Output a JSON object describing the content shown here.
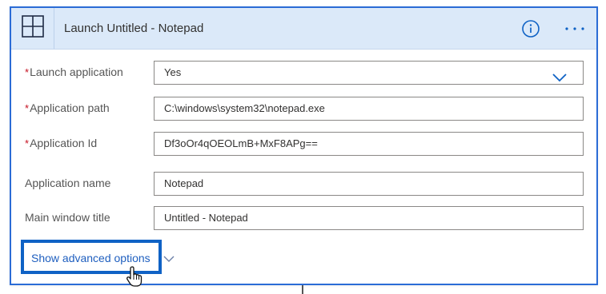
{
  "card": {
    "title": "Launch Untitled - Notepad",
    "icon": "window-layout-icon",
    "info_icon": "info-icon",
    "more_icon": "more-options-icon"
  },
  "fields": {
    "launch_application": {
      "label": "Launch application",
      "required": "*",
      "value": "Yes"
    },
    "application_path": {
      "label": "Application path",
      "required": "*",
      "value": "C:\\windows\\system32\\notepad.exe"
    },
    "application_id": {
      "label": "Application Id",
      "required": "*",
      "value": "Df3oOr4qOEOLmB+MxF8APg=="
    },
    "application_name": {
      "label": "Application name",
      "value": "Notepad"
    },
    "main_window_title": {
      "label": "Main window title",
      "value": "Untitled - Notepad"
    }
  },
  "advanced": {
    "label": "Show advanced options"
  },
  "colors": {
    "accent": "#0f62c5",
    "header_bg": "#dbe9f9",
    "required": "#c50f1f"
  }
}
